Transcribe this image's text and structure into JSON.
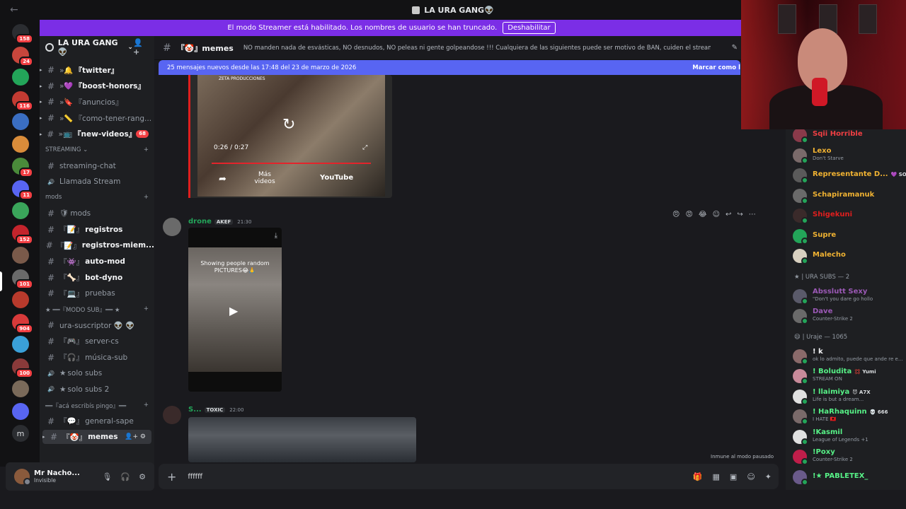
{
  "window": {
    "title": "LA URA GANG👽"
  },
  "banner": {
    "text": "El modo Streamer está habilitado. Los nombres de usuario se han truncado.",
    "button": "Deshabilitar"
  },
  "rail": {
    "servers": [
      {
        "color": "#2b2d31",
        "badge": "158",
        "icon": "discord-home-icon"
      },
      {
        "color": "#c8463c",
        "badge": "24"
      },
      {
        "color": "#23a559",
        "badge": ""
      },
      {
        "color": "#c23b32",
        "badge": "116"
      },
      {
        "color": "#3a6ec2",
        "badge": ""
      },
      {
        "color": "#d98c3a",
        "badge": ""
      },
      {
        "color": "#4a8a3a",
        "badge": "17"
      },
      {
        "color": "#5865f2",
        "badge": "11"
      },
      {
        "color": "#3aa55a",
        "badge": ""
      },
      {
        "color": "#c4242c",
        "badge": "152"
      },
      {
        "color": "#7a5a4a",
        "badge": ""
      },
      {
        "color": "#6a6a6a",
        "badge": "101"
      },
      {
        "color": "#b83a2c",
        "badge": ""
      },
      {
        "color": "#d83a3a",
        "badge": "904"
      },
      {
        "color": "#3aa0d8",
        "badge": ""
      },
      {
        "color": "#8a3a3a",
        "badge": "100"
      },
      {
        "color": "#7a6a5a",
        "badge": ""
      },
      {
        "color": "#5865f2",
        "badge": "",
        "icon": "folder-icon"
      },
      {
        "color": "#2b2d31",
        "badge": "",
        "letter": "m"
      }
    ]
  },
  "server": {
    "name": "LA URA GANG👽"
  },
  "channels": [
    {
      "prefix": "»🔔",
      "name": "『twitter』",
      "bold": true,
      "type": "text",
      "arrow": true
    },
    {
      "prefix": "»💜",
      "name": "『boost-honors』",
      "bold": true,
      "type": "text",
      "arrow": true
    },
    {
      "prefix": "»🔖",
      "name": "『anuncios』",
      "bold": false,
      "type": "text",
      "arrow": true
    },
    {
      "prefix": "»📏",
      "name": "『como-tener-rang...",
      "bold": false,
      "type": "text",
      "arrow": true
    },
    {
      "prefix": "»📺",
      "name": "『new-videos』",
      "bold": true,
      "type": "text",
      "arrow": true,
      "count": "68"
    },
    {
      "category": "STREAMING ⌄"
    },
    {
      "prefix": "",
      "name": "streaming-chat",
      "bold": false,
      "type": "text"
    },
    {
      "prefix": "",
      "name": "Llamada Stream",
      "bold": false,
      "type": "voice"
    },
    {
      "category": "mods"
    },
    {
      "prefix": "🛡",
      "name": "mods",
      "bold": false,
      "type": "text"
    },
    {
      "prefix": "『📝』",
      "name": "registros",
      "bold": true,
      "type": "text"
    },
    {
      "prefix": "『📝』",
      "name": "registros-miem...",
      "bold": true,
      "type": "text"
    },
    {
      "prefix": "『👾』",
      "name": "auto-mod",
      "bold": true,
      "type": "text"
    },
    {
      "prefix": "『🦴』",
      "name": "bot-dyno",
      "bold": true,
      "type": "text"
    },
    {
      "prefix": "『💻』",
      "name": "pruebas",
      "bold": false,
      "type": "text"
    },
    {
      "category": "★ ══『MODO SUB』══ ★"
    },
    {
      "prefix": "",
      "name": "ura-suscriptor 👽 👽",
      "bold": false,
      "type": "text"
    },
    {
      "prefix": "『🎮』",
      "name": "server-cs",
      "bold": false,
      "type": "text"
    },
    {
      "prefix": "『🎧』",
      "name": "música-sub",
      "bold": false,
      "type": "text"
    },
    {
      "prefix": "★",
      "name": "solo subs",
      "bold": false,
      "type": "voice"
    },
    {
      "prefix": "★",
      "name": "solo subs 2",
      "bold": false,
      "type": "voice"
    },
    {
      "category": "══『acá escribís pingo』══"
    },
    {
      "prefix": "『💬』",
      "name": "general-sape",
      "bold": false,
      "type": "text"
    },
    {
      "prefix": "『🤡』",
      "name": "memes",
      "bold": true,
      "type": "text",
      "active": true,
      "arrow": true
    }
  ],
  "user": {
    "name": "Mr Nacho...",
    "status": "Invisible"
  },
  "header": {
    "channel": "『🤡』memes",
    "topic": "NO manden nada de esvásticas, NO desnudos, NO peleas ni gente golpeandose !!! Cualquiera de las siguientes puede ser motivo de BAN, cuiden el stream!"
  },
  "newbar": {
    "text": "25 mensajes nuevos desde las 17:48 del 23 de marzo de 2026",
    "action": "Marcar como l"
  },
  "video1": {
    "time": "0:26 / 0:27",
    "more": "Más videos",
    "brand": "YouTube",
    "channel": "ZETA PRODUCCIONES"
  },
  "messages": [
    {
      "author": "drone",
      "tag": "AKEF",
      "time": "21:30",
      "color": "#23a559",
      "caption": "Showing people random PICTURES😂🙏"
    },
    {
      "author": "S...",
      "tag": "TOXIC",
      "time": "22:00",
      "color": "#23a559"
    }
  ],
  "paused": "Inmune al modo pausado",
  "composer": {
    "text": "ffffff"
  },
  "members": [
    {
      "name": "Sqii Horrible",
      "status": "",
      "color": "#f23f43",
      "av": "#8a3a4a"
    },
    {
      "name": "Lexo",
      "status": "Don't Starve",
      "color": "#f0b232",
      "av": "#7a6a6a"
    },
    {
      "name": "Representante D...",
      "status": "",
      "color": "#f0b232",
      "av": "#5a5a5a",
      "tag": "💜 SOTE"
    },
    {
      "name": "Schapiramanuk",
      "status": "",
      "color": "#f0b232",
      "av": "#6a6a6a"
    },
    {
      "name": "Shigekuni",
      "status": "",
      "color": "#e01e1e",
      "av": "#3a2a2a"
    },
    {
      "name": "Supre",
      "status": "",
      "color": "#f0b232",
      "av": "#23a559"
    },
    {
      "name": "Malecho",
      "status": "",
      "color": "#f0b232",
      "av": "#d8d0c0"
    },
    {
      "group": "★ | URA SUBS — 2"
    },
    {
      "name": "Absslutt Sexy",
      "status": "\"Don't you dare go hollo",
      "color": "#9b59b6",
      "av": "#5a5a6a"
    },
    {
      "name": "Dave",
      "status": "Counter-Strike 2",
      "color": "#9b59b6",
      "av": "#6a6a6a"
    },
    {
      "group": "😄 | Uraje — 1065"
    },
    {
      "name": "! k",
      "status": "ok lo admito, puede que ande re e...",
      "color": "#f2f3f5",
      "av": "#8a6a6a"
    },
    {
      "name": "! Boludita",
      "status": "STREAM ON",
      "color": "#57f287",
      "av": "#c88a9a",
      "tag": "💢 Yumi"
    },
    {
      "name": "! llaimiya",
      "status": "Life is but a dream...",
      "color": "#57f287",
      "av": "#e0e0e0",
      "tag": "😈 A7X"
    },
    {
      "name": "! HaRhaquinn",
      "status": "I HATE 🇦🇱",
      "color": "#57f287",
      "av": "#7a6a6a",
      "tag": "💀 666"
    },
    {
      "name": "!Kasmil",
      "status": "League of Legends +1",
      "color": "#57f287",
      "av": "#e0e0e0"
    },
    {
      "name": "!Poxy",
      "status": "Counter-Strike 2",
      "color": "#57f287",
      "av": "#c01e4a"
    },
    {
      "name": "!★ PABLETEX_",
      "status": "",
      "color": "#57f287",
      "av": "#6a5a8a"
    }
  ]
}
